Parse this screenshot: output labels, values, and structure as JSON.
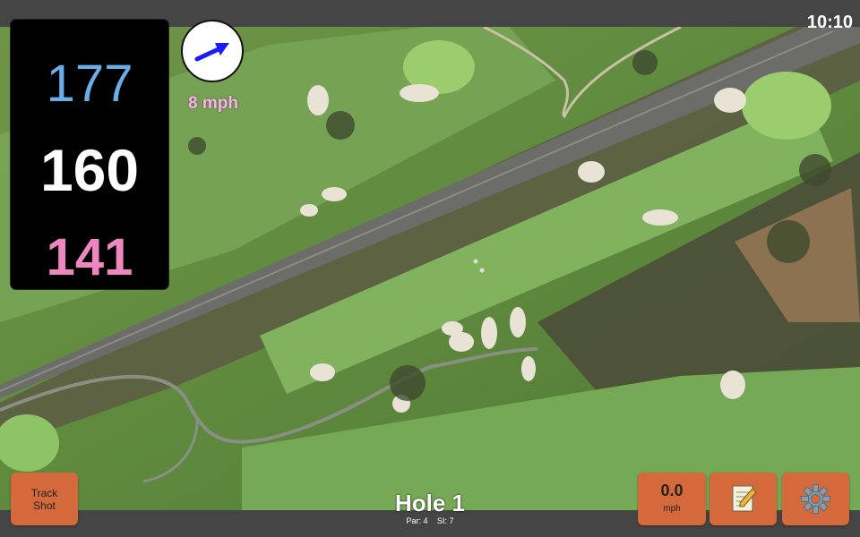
{
  "status_bar": {
    "time": "10:10"
  },
  "yardages": {
    "back": "177",
    "middle": "160",
    "front": "141"
  },
  "wind": {
    "speed_label": "8 mph",
    "direction_icon": "wind-arrow-icon",
    "arrow_color": "#1a1aff"
  },
  "buttons": {
    "track_shot_line1": "Track",
    "track_shot_line2": "Shot",
    "speed_value": "0.0",
    "speed_unit": "mph",
    "notes_icon": "notepad-icon",
    "settings_icon": "gear-icon"
  },
  "hole": {
    "title": "Hole 1",
    "par": "Par: 4",
    "si": "SI: 7"
  },
  "colors": {
    "button_bg": "#d46a3c",
    "back_yardage": "#6aaee9",
    "middle_yardage": "#ffffff",
    "front_yardage": "#ee86bf",
    "wind_label": "#f2b8e0"
  }
}
